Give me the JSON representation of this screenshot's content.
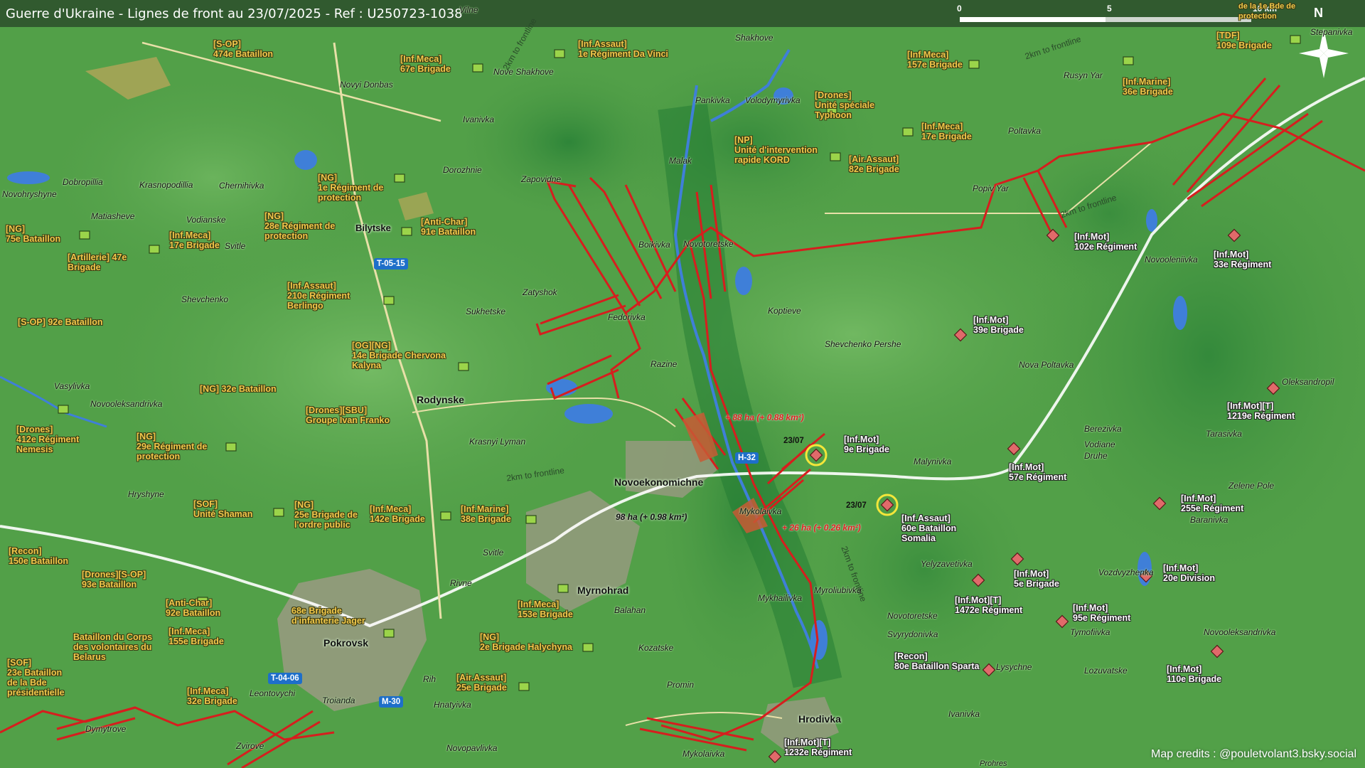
{
  "title": "Guerre d'Ukraine - Lignes de front au 23/07/2025 - Ref : U250723-1038",
  "scale": {
    "l0": "0",
    "l5": "5",
    "l10": "10 km",
    "north": "N"
  },
  "credits": "Map credits : @pouletvolant3.bsky.social",
  "colors": {
    "frontline": "#d61e1e",
    "water": "#3f7fd8",
    "forest": "#2f8a3a",
    "ua_label": "#f2c94c",
    "ru_label": "#ffffff"
  },
  "ua_units": [
    {
      "id": "u1",
      "text": "[S-OP]\n474e Bataillon"
    },
    {
      "id": "u2",
      "text": "[Inf.Meca]\n67e Brigade"
    },
    {
      "id": "u3",
      "text": "[Inf.Assaut]\n1e Régiment Da Vinci"
    },
    {
      "id": "u4",
      "text": "[NG]\n1e Régiment de\nprotection"
    },
    {
      "id": "u5",
      "text": "[NG]\n28e Régiment de\nprotection"
    },
    {
      "id": "u6",
      "text": "[Anti-Char]\n91e Bataillon"
    },
    {
      "id": "u7",
      "text": "[NG]\n75e Bataillon"
    },
    {
      "id": "u8",
      "text": "[Inf.Meca]\n17e Brigade"
    },
    {
      "id": "u9",
      "text": "[Artillerie] 47e\nBrigade"
    },
    {
      "id": "u10",
      "text": "[Inf.Assaut]\n210e Régiment\nBerlingo"
    },
    {
      "id": "u11",
      "text": "[S-OP] 92e Bataillon"
    },
    {
      "id": "u12",
      "text": "[OG][NG]\n14e Brigade Chervona\nKalyna"
    },
    {
      "id": "u13",
      "text": "[NG] 32e Bataillon"
    },
    {
      "id": "u14",
      "text": "[Drones][SBU]\nGroupe Ivan Franko"
    },
    {
      "id": "u15",
      "text": "[Drones]\n412e Régiment\nNemesis"
    },
    {
      "id": "u16",
      "text": "[NG]\n29e Régiment de\nprotection"
    },
    {
      "id": "u17",
      "text": "[SOF]\nUnité Shaman"
    },
    {
      "id": "u18",
      "text": "[NG]\n25e Brigade de\nl'ordre public"
    },
    {
      "id": "u19",
      "text": "[Inf.Meca]\n142e Brigade"
    },
    {
      "id": "u20",
      "text": "[Inf.Marine]\n38e Brigade"
    },
    {
      "id": "u21",
      "text": "[Recon]\n150e Bataillon"
    },
    {
      "id": "u22",
      "text": "[Drones][S-OP]\n93e Bataillon"
    },
    {
      "id": "u23",
      "text": "[Anti-Char]\n92e Bataillon"
    },
    {
      "id": "u24",
      "text": "68e Brigade\nd'infanterie Jager"
    },
    {
      "id": "u25",
      "text": "[Inf.Meca]\n155e Brigade"
    },
    {
      "id": "u26",
      "text": "Bataillon du Corps\ndes volontaires du\nBelarus"
    },
    {
      "id": "u27",
      "text": "[SOF]\n23e Bataillon\nde la Bde\nprésidentielle"
    },
    {
      "id": "u28",
      "text": "[Inf.Meca]\n32e Brigade"
    },
    {
      "id": "u29",
      "text": "[Inf.Meca]\n153e Brigade"
    },
    {
      "id": "u30",
      "text": "[NG]\n2e Brigade Halychyna"
    },
    {
      "id": "u31",
      "text": "[Air.Assaut]\n25e Brigade"
    },
    {
      "id": "u32",
      "text": "[Inf.Meca]\n157e Brigade"
    },
    {
      "id": "u33",
      "text": "[Drones]\nUnité spéciale\nTyphoon"
    },
    {
      "id": "u34",
      "text": "[NP]\nUnité d'intervention\nrapide KORD"
    },
    {
      "id": "u35",
      "text": "[Inf.Meca]\n17e Brigade"
    },
    {
      "id": "u36",
      "text": "[Air.Assaut]\n82e Brigade"
    },
    {
      "id": "u37",
      "text": "[Inf.Marine]\n36e Brigade"
    },
    {
      "id": "u38",
      "text": "[TDF]\n109e Brigade"
    },
    {
      "id": "u39",
      "text": "de la 1e Bde de\nprotection"
    }
  ],
  "ru_units": [
    {
      "id": "r1",
      "text": "[Inf.Mot]\n102e Régiment"
    },
    {
      "id": "r2",
      "text": "[Inf.Mot]\n33e Régiment"
    },
    {
      "id": "r3",
      "text": "[Inf.Mot]\n39e Brigade"
    },
    {
      "id": "r4",
      "text": "[Inf.Mot]\n9e Brigade"
    },
    {
      "id": "r5",
      "text": "[Inf.Mot]\n57e Régiment"
    },
    {
      "id": "r6",
      "text": "[Inf.Assaut]\n60e Bataillon\nSomalia"
    },
    {
      "id": "r7",
      "text": "[Inf.Mot]\n5e Brigade"
    },
    {
      "id": "r8",
      "text": "[Inf.Mot][T]\n1472e Régiment"
    },
    {
      "id": "r9",
      "text": "[Inf.Mot]\n95e Régiment"
    },
    {
      "id": "r10",
      "text": "[Inf.Mot]\n20e Division"
    },
    {
      "id": "r11",
      "text": "[Inf.Mot]\n255e Régiment"
    },
    {
      "id": "r12",
      "text": "[Inf.Mot][T]\n1219e Régiment"
    },
    {
      "id": "r13",
      "text": "[Recon]\n80e Bataillon Sparta"
    },
    {
      "id": "r14",
      "text": "[Inf.Mot]\n110e Brigade"
    },
    {
      "id": "r15",
      "text": "[Inf.Mot][T]\n1232e Régiment"
    }
  ],
  "places": [
    "Vilne",
    "Shakhove",
    "Novyi Donbas",
    "Nove Shakhove",
    "Ivanivka",
    "Pankivka",
    "Volodymyrivka",
    "Malak",
    "Zapovidne",
    "Dobropillia",
    "Krasnopodillia",
    "Chernihivka",
    "Dorozhnie",
    "Novohryshyne",
    "Matiasheve",
    "Vodianske",
    "Svitle",
    "Bilytske",
    "Boikivka",
    "Novotoretske",
    "Popiv Yar",
    "Poltavka",
    "Rusyn Yar",
    "Stepanivka",
    "Shevchenko",
    "Zatyshok",
    "Sukhetske",
    "Fedorivka",
    "Koptieve",
    "Novooleniivka",
    "Shevchenko Pershe",
    "Nova Poltavka",
    "Oleksandropil",
    "Vasylivka",
    "Novooleksandrivka",
    "Razine",
    "Krasnyi Lyman",
    "Berezivka",
    "Vodiane Druhe",
    "Tarasivka",
    "Malynivka",
    "Zelene Pole",
    "Hryshyne",
    "Mykolaivka",
    "Baranivka",
    "Rivne",
    "Svitle",
    "Yelyzavetivka",
    "Vozdvyzhenka",
    "Balahan",
    "Myroliubivka",
    "Mykhailivka",
    "Novotoretske",
    "Svyrydonivka",
    "Tymofiivka",
    "Novooleksandrivka",
    "Kozatske",
    "Lysychne",
    "Lozuvatske",
    "Rih",
    "Leontovychi",
    "Troianda",
    "Hnatyivka",
    "Promin",
    "Ivanivka",
    "Dymytrove",
    "Zvirove",
    "Novopavlivka",
    "Mykolaivka",
    "Prohres"
  ],
  "towns": [
    "Rodynske",
    "Novoekonomichne",
    "Myrnohrad",
    "Pokrovsk",
    "Hrodivka"
  ],
  "roads": [
    "T-05-15",
    "H-32",
    "T-04-06",
    "M-30"
  ],
  "gains": [
    "+ 88 ha (+ 0.88 km²)",
    "98 ha (+ 0.98 km²)",
    "+ 26 ha (+ 0.26 km²)"
  ],
  "dates": [
    "23/07",
    "23/07"
  ],
  "frontline_labels": [
    "2km to frontline",
    "2km to frontline",
    "2km to frontline",
    "2km to frontline",
    "2km to frontline"
  ]
}
